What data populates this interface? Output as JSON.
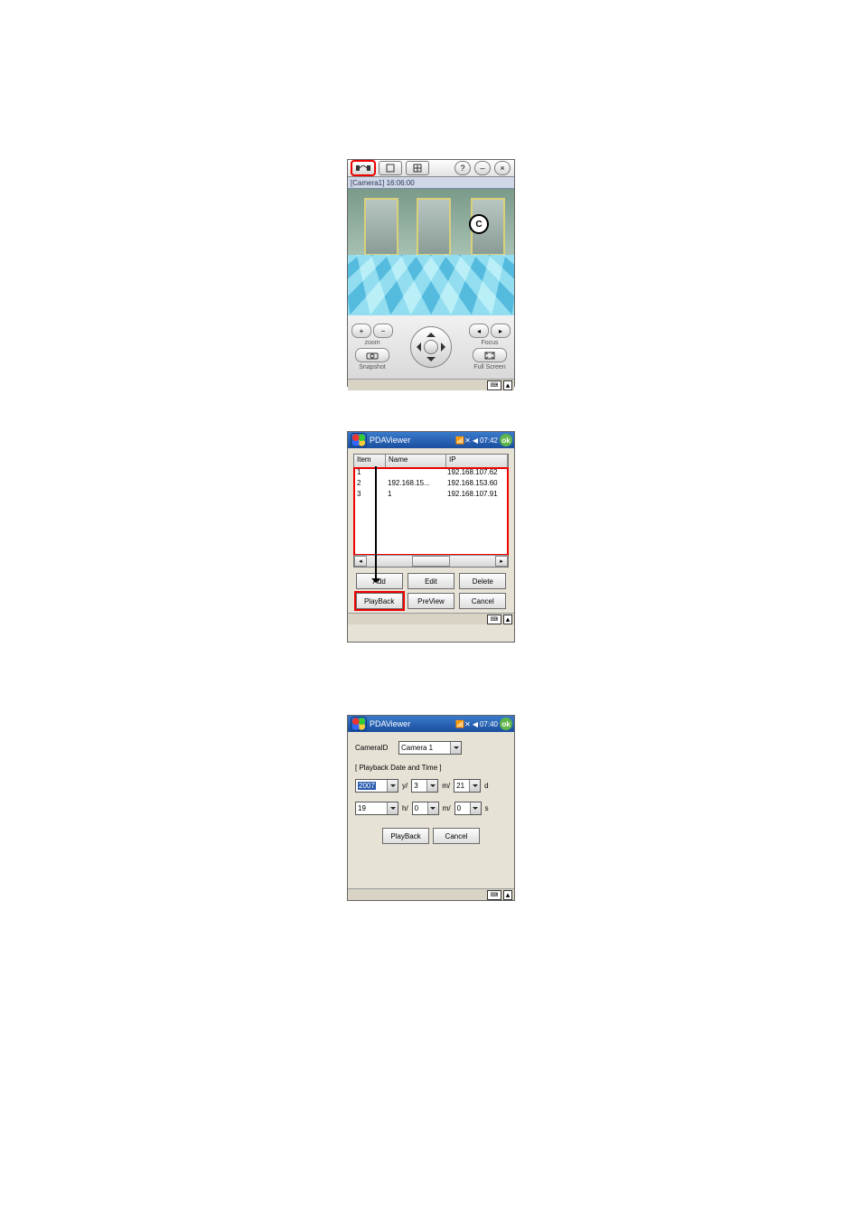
{
  "viewer": {
    "camera_label": "[Camera1] 16:06:00",
    "overlay_letter": "C",
    "zoom_label": "zoom",
    "focus_label": "Focus",
    "snapshot_label": "Snapshot",
    "fullscreen_label": "Full Screen"
  },
  "list_window": {
    "title": "PDAViewer",
    "time": "07:42",
    "ok": "ok",
    "headers": {
      "item": "Item",
      "name": "Name",
      "ip": "IP"
    },
    "rows": [
      {
        "item": "1",
        "name": "",
        "ip": "192.168.107.62"
      },
      {
        "item": "2",
        "name": "192.168.15...",
        "ip": "192.168.153.60"
      },
      {
        "item": "3",
        "name": "1",
        "ip": "192.168.107.91"
      }
    ],
    "buttons": {
      "add": "Add",
      "edit": "Edit",
      "delete": "Delete",
      "playback": "PlayBack",
      "preview": "PreView",
      "cancel": "Cancel"
    }
  },
  "playback_window": {
    "title": "PDAViewer",
    "time": "07:40",
    "ok": "ok",
    "camera_id_label": "CameraID",
    "camera_selected": "Camera 1",
    "group_label": "[ Playback Date and Time ]",
    "date": {
      "year": "2007",
      "y": "y/",
      "month": "3",
      "m": "m/",
      "day": "21",
      "d": "d"
    },
    "time_row": {
      "hour": "19",
      "h": "h/",
      "min": "0",
      "m": "m/",
      "sec": "0",
      "s": "s"
    },
    "buttons": {
      "playback": "PlayBack",
      "cancel": "Cancel"
    }
  }
}
